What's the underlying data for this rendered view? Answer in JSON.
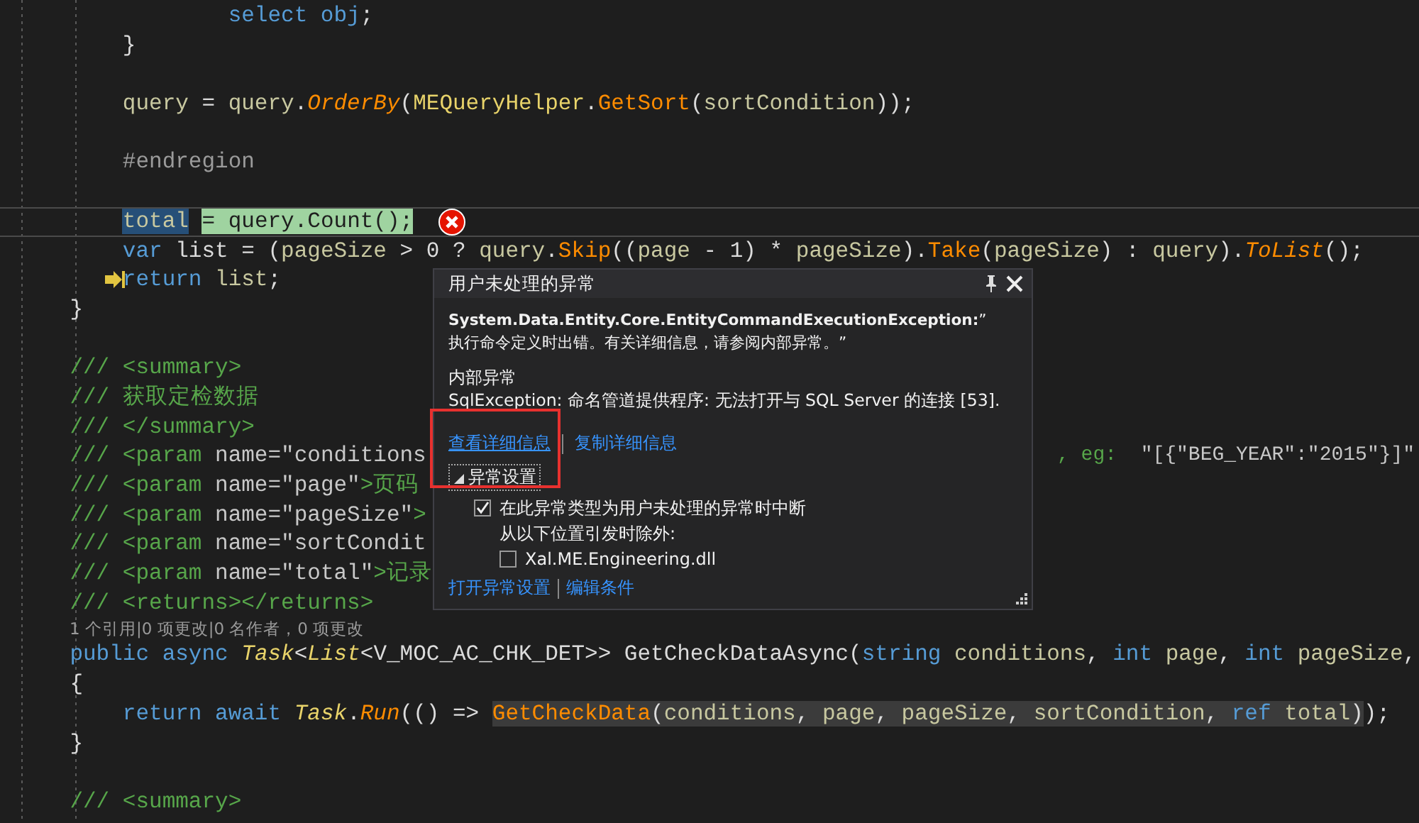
{
  "code_lines": [
    {
      "tokens": [
        {
          "kind": "kw",
          "text": "                select obj"
        },
        {
          "kind": "plain",
          "text": ";"
        }
      ]
    },
    {
      "tokens": [
        {
          "kind": "plain",
          "text": "        }"
        }
      ]
    },
    {
      "kind": "blank"
    },
    {
      "tokens": [
        {
          "kind": "var",
          "text": "        query"
        },
        {
          "kind": "plain",
          "text": " = "
        },
        {
          "kind": "var",
          "text": "query"
        },
        {
          "kind": "plain",
          "text": "."
        },
        {
          "kind": "method-i",
          "text": "OrderBy"
        },
        {
          "kind": "plain",
          "text": "("
        },
        {
          "kind": "type",
          "text": "MEQueryHelper"
        },
        {
          "kind": "plain",
          "text": "."
        },
        {
          "kind": "method",
          "text": "GetSort"
        },
        {
          "kind": "plain",
          "text": "("
        },
        {
          "kind": "var",
          "text": "sortCondition"
        },
        {
          "kind": "plain",
          "text": "));"
        }
      ]
    },
    {
      "kind": "blank"
    },
    {
      "tokens": [
        {
          "kind": "pre",
          "text": "        #endregion"
        }
      ]
    },
    {
      "kind": "blank"
    },
    {
      "current": true,
      "error": true,
      "tokens": [
        {
          "kind": "var",
          "text": "        total",
          "selected": true
        },
        {
          "kind": "plain",
          "text": " = query.Count();",
          "current_statement": true
        }
      ]
    },
    {
      "tokens": [
        {
          "kind": "kw",
          "text": "        var "
        },
        {
          "kind": "plain",
          "text": "list = ("
        },
        {
          "kind": "var",
          "text": "pageSize"
        },
        {
          "kind": "plain",
          "text": " > 0 ? "
        },
        {
          "kind": "var",
          "text": "query"
        },
        {
          "kind": "plain",
          "text": "."
        },
        {
          "kind": "method",
          "text": "Skip"
        },
        {
          "kind": "plain",
          "text": "(("
        },
        {
          "kind": "var",
          "text": "page"
        },
        {
          "kind": "plain",
          "text": " - 1) * "
        },
        {
          "kind": "var",
          "text": "pageSize"
        },
        {
          "kind": "plain",
          "text": ")."
        },
        {
          "kind": "method",
          "text": "Take"
        },
        {
          "kind": "plain",
          "text": "("
        },
        {
          "kind": "var",
          "text": "pageSize"
        },
        {
          "kind": "plain",
          "text": ") : "
        },
        {
          "kind": "var",
          "text": "query"
        },
        {
          "kind": "plain",
          "text": ")."
        },
        {
          "kind": "method-i",
          "text": "ToList"
        },
        {
          "kind": "plain",
          "text": "();"
        }
      ]
    },
    {
      "next_statement": true,
      "tokens": [
        {
          "kind": "kw",
          "text": "        return "
        },
        {
          "kind": "var",
          "text": "list"
        },
        {
          "kind": "plain",
          "text": ";"
        }
      ]
    },
    {
      "tokens": [
        {
          "kind": "plain",
          "text": "    }"
        }
      ]
    },
    {
      "kind": "blank"
    },
    {
      "tokens": [
        {
          "kind": "doc",
          "text": "    /// <summary>"
        }
      ]
    },
    {
      "tokens": [
        {
          "kind": "doc",
          "text": "    /// 获取定检数据"
        }
      ]
    },
    {
      "tokens": [
        {
          "kind": "doc",
          "text": "    /// </summary>"
        }
      ]
    },
    {
      "tokens": [
        {
          "kind": "doc",
          "text": "    /// <param "
        },
        {
          "kind": "docattr",
          "text": "name=\"conditions"
        }
      ],
      "tail": [
        {
          "kind": "doc",
          "text": ", eg:  "
        },
        {
          "kind": "docattr",
          "text": "\"[{\"BEG_YEAR\":\"2015\"}]\""
        }
      ]
    },
    {
      "tokens": [
        {
          "kind": "doc",
          "text": "    /// <param "
        },
        {
          "kind": "docattr",
          "text": "name=\"page\""
        },
        {
          "kind": "doc",
          "text": ">页码"
        }
      ]
    },
    {
      "tokens": [
        {
          "kind": "doc",
          "text": "    /// <param "
        },
        {
          "kind": "docattr",
          "text": "name=\"pageSize\""
        },
        {
          "kind": "doc",
          "text": ">"
        }
      ]
    },
    {
      "tokens": [
        {
          "kind": "doc",
          "text": "    /// <param "
        },
        {
          "kind": "docattr",
          "text": "name=\"sortCondit"
        }
      ]
    },
    {
      "tokens": [
        {
          "kind": "doc",
          "text": "    /// <param "
        },
        {
          "kind": "docattr",
          "text": "name=\"total\""
        },
        {
          "kind": "doc",
          "text": ">记录"
        }
      ]
    },
    {
      "tokens": [
        {
          "kind": "doc",
          "text": "    /// <returns></returns>"
        }
      ]
    },
    {
      "kind": "codelens",
      "text": "1 个引用|0 项更改|0 名作者，0 项更改"
    },
    {
      "tokens": [
        {
          "kind": "kw",
          "text": "    public async "
        },
        {
          "kind": "type-i",
          "text": "Task"
        },
        {
          "kind": "plain",
          "text": "<"
        },
        {
          "kind": "type-i",
          "text": "List"
        },
        {
          "kind": "plain",
          "text": "<V_MOC_AC_CHK_DET>> GetCheckDataAsync("
        },
        {
          "kind": "kw",
          "text": "string "
        },
        {
          "kind": "var",
          "text": "conditions"
        },
        {
          "kind": "plain",
          "text": ", "
        },
        {
          "kind": "kw",
          "text": "int "
        },
        {
          "kind": "var",
          "text": "page"
        },
        {
          "kind": "plain",
          "text": ", "
        },
        {
          "kind": "kw",
          "text": "int "
        },
        {
          "kind": "var",
          "text": "pageSize"
        },
        {
          "kind": "plain",
          "text": ","
        }
      ]
    },
    {
      "tokens": [
        {
          "kind": "plain",
          "text": "    {"
        }
      ]
    },
    {
      "tokens": [
        {
          "kind": "kw",
          "text": "        return await "
        },
        {
          "kind": "type-i",
          "text": "Task"
        },
        {
          "kind": "plain",
          "text": "."
        },
        {
          "kind": "method-i",
          "text": "Run"
        },
        {
          "kind": "plain",
          "text": "(() => "
        },
        {
          "kind": "method",
          "text": "GetCheckData",
          "reference_highlight": true
        },
        {
          "kind": "plain",
          "text": "(",
          "reference_highlight": true
        },
        {
          "kind": "var",
          "text": "conditions",
          "reference_highlight": true
        },
        {
          "kind": "plain",
          "text": ", ",
          "reference_highlight": true
        },
        {
          "kind": "var",
          "text": "page",
          "reference_highlight": true
        },
        {
          "kind": "plain",
          "text": ", ",
          "reference_highlight": true
        },
        {
          "kind": "var",
          "text": "pageSize",
          "reference_highlight": true
        },
        {
          "kind": "plain",
          "text": ", ",
          "reference_highlight": true
        },
        {
          "kind": "var",
          "text": "sortCondition",
          "reference_highlight": true
        },
        {
          "kind": "plain",
          "text": ", ",
          "reference_highlight": true
        },
        {
          "kind": "kw",
          "text": "ref ",
          "reference_highlight": true
        },
        {
          "kind": "var",
          "text": "total",
          "reference_highlight": true
        },
        {
          "kind": "plain",
          "text": ")",
          "reference_highlight": true
        },
        {
          "kind": "plain",
          "text": ");"
        }
      ]
    },
    {
      "tokens": [
        {
          "kind": "plain",
          "text": "    }"
        }
      ]
    },
    {
      "kind": "blank"
    },
    {
      "tokens": [
        {
          "kind": "doc",
          "text": "    /// <summary>"
        }
      ]
    }
  ],
  "exception_popup": {
    "title": "用户未处理的异常",
    "message": "**System.Data.Entity.Core.EntityCommandExecutionException:**”\n执行命令定义时出错。有关详细信息，请参阅内部异常。”",
    "inner_heading": "内部异常",
    "inner_message": "SqlException: 命名管道提供程序: 无法打开与 SQL Server 的连接 [53].",
    "links": [
      "查看详细信息",
      "复制详细信息"
    ],
    "settings": {
      "label": "异常设置",
      "expanded": true,
      "break_option": {
        "label": "在此异常类型为用户未处理的异常时中断",
        "checked": true
      },
      "except_label": "从以下位置引发时除外:",
      "modules": [
        {
          "label": "Xal.ME.Engineering.dll",
          "checked": false
        }
      ],
      "links": [
        "打开异常设置",
        "编辑条件"
      ]
    }
  }
}
